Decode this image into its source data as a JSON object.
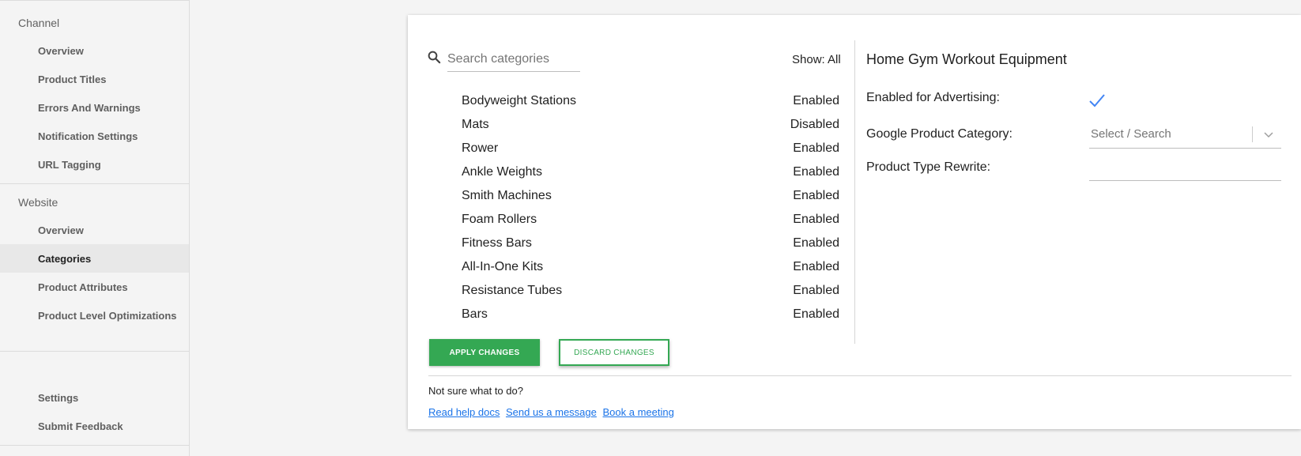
{
  "sidebar": {
    "channel_label": "Channel",
    "channel_items": [
      {
        "label": "Overview"
      },
      {
        "label": "Product Titles"
      },
      {
        "label": "Errors And Warnings"
      },
      {
        "label": "Notification Settings"
      },
      {
        "label": "URL Tagging"
      }
    ],
    "website_label": "Website",
    "website_items": [
      {
        "label": "Overview"
      },
      {
        "label": "Categories",
        "active": true
      },
      {
        "label": "Product Attributes"
      },
      {
        "label": "Product Level Optimizations"
      }
    ],
    "bottom_items": [
      {
        "label": "Settings"
      },
      {
        "label": "Submit Feedback"
      }
    ]
  },
  "categories": {
    "search_placeholder": "Search categories",
    "show_filter": "Show: All",
    "rows": [
      {
        "name": "Bodyweight Stations",
        "status": "Enabled"
      },
      {
        "name": "Mats",
        "status": "Disabled"
      },
      {
        "name": "Rower",
        "status": "Enabled"
      },
      {
        "name": "Ankle Weights",
        "status": "Enabled"
      },
      {
        "name": "Smith Machines",
        "status": "Enabled"
      },
      {
        "name": "Foam Rollers",
        "status": "Enabled"
      },
      {
        "name": "Fitness Bars",
        "status": "Enabled"
      },
      {
        "name": "All-In-One Kits",
        "status": "Enabled"
      },
      {
        "name": "Resistance Tubes",
        "status": "Enabled"
      },
      {
        "name": "Bars",
        "status": "Enabled"
      }
    ],
    "apply_label": "APPLY CHANGES",
    "discard_label": "DISCARD CHANGES"
  },
  "detail": {
    "title": "Home Gym Workout Equipment",
    "enabled_label": "Enabled for Advertising:",
    "enabled_value": true,
    "gpc_label": "Google Product Category:",
    "gpc_placeholder": "Select / Search",
    "rewrite_label": "Product Type Rewrite:",
    "rewrite_value": ""
  },
  "help": {
    "question": "Not sure what to do?",
    "links": [
      "Read help docs",
      "Send us a message",
      "Book a meeting"
    ]
  },
  "colors": {
    "accent_green": "#34a853",
    "link_blue": "#1a73e8",
    "check_blue": "#4285f4"
  },
  "icons": {
    "search": "search-icon",
    "check": "checkmark-icon",
    "chevron": "chevron-down-icon"
  }
}
